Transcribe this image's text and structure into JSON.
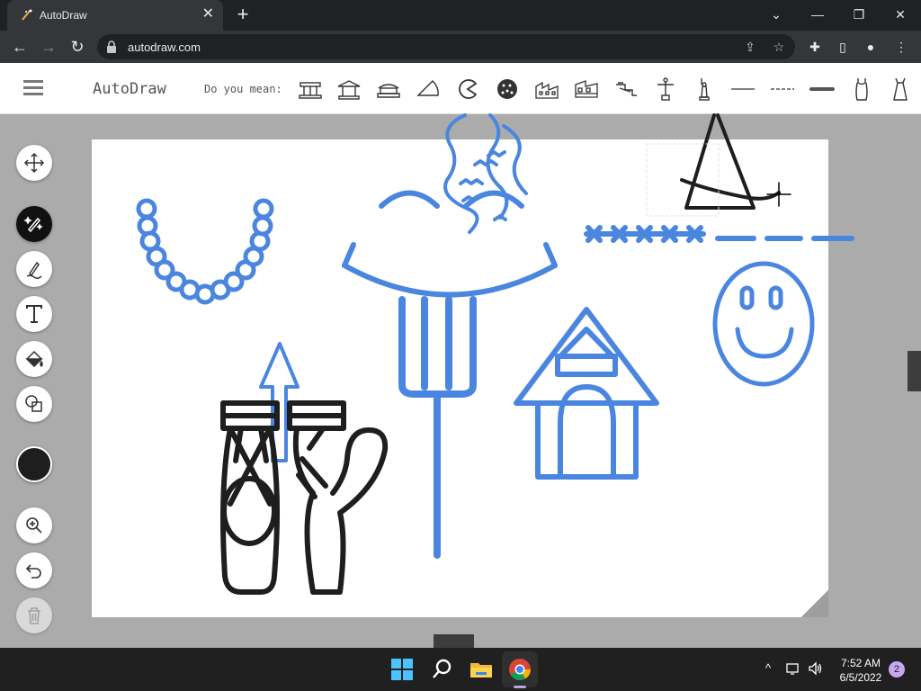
{
  "browser": {
    "tab_title": "AutoDraw",
    "tab_close": "✕",
    "new_tab": "+",
    "url": "autodraw.com",
    "controls": {
      "minimize": "⌄",
      "restore": "—",
      "maximize": "❐",
      "close": "✕"
    }
  },
  "nav": {
    "back": "←",
    "forward": "→",
    "reload": "↻"
  },
  "app": {
    "logo": "AutoDraw",
    "suggestion_prompt": "Do you mean:",
    "suggestions": [
      "temple",
      "pavilion",
      "pagoda",
      "pizza-slice",
      "pac-man",
      "pie",
      "factory",
      "train",
      "stairs",
      "statue",
      "statue-of-liberty",
      "line",
      "dashed-line",
      "thick-line",
      "dress",
      "dress-2"
    ]
  },
  "tools": [
    "select",
    "autodraw",
    "draw",
    "type",
    "fill",
    "shape",
    "zoom",
    "undo",
    "delete"
  ],
  "colors": {
    "brand_blue": "#4a86e0",
    "ink": "#1e1e1e",
    "selected_color": "#1e1e1e"
  },
  "taskbar": {
    "time": "7:52 AM",
    "date": "6/5/2022",
    "notifications": "2",
    "tray_chevron": "^"
  }
}
